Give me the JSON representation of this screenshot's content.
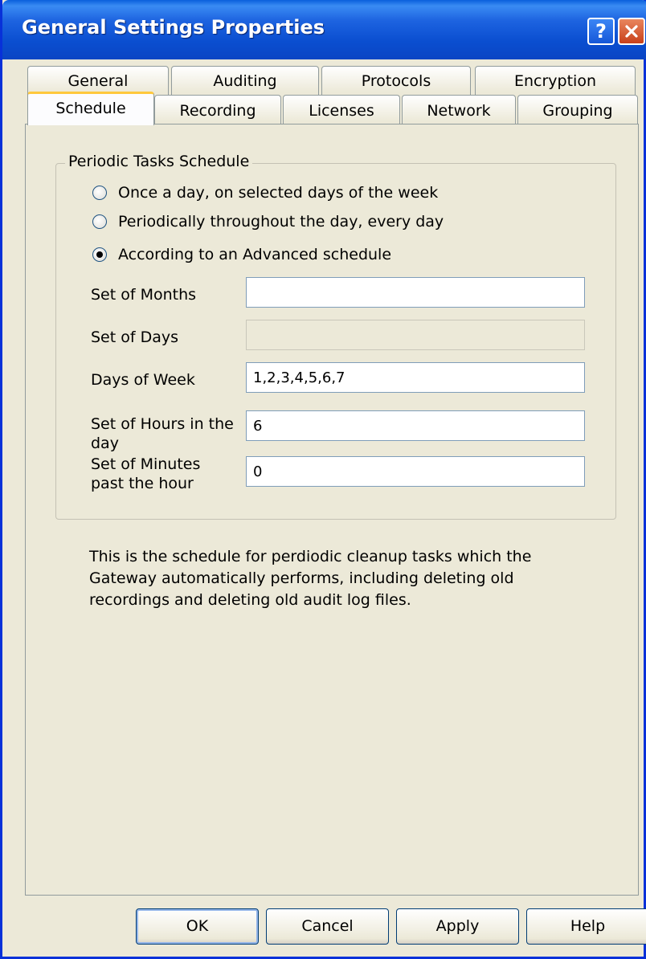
{
  "window": {
    "title": "General Settings Properties",
    "help_glyph": "?",
    "close_glyph": "×"
  },
  "tabs_back": [
    {
      "label": "General"
    },
    {
      "label": "Auditing"
    },
    {
      "label": "Protocols"
    },
    {
      "label": "Encryption"
    }
  ],
  "tabs_front": [
    {
      "label": "Schedule",
      "active": true
    },
    {
      "label": "Recording"
    },
    {
      "label": "Licenses"
    },
    {
      "label": "Network"
    },
    {
      "label": "Grouping"
    }
  ],
  "schedule": {
    "group_title": "Periodic Tasks Schedule",
    "radios": [
      {
        "label": "Once a day, on selected days of the week",
        "checked": false
      },
      {
        "label": "Periodically throughout the day, every day",
        "checked": false
      },
      {
        "label": "According to an Advanced schedule",
        "checked": true
      }
    ],
    "fields": [
      {
        "label": "Set of Months",
        "value": ""
      },
      {
        "label": "Set of Days",
        "value": ""
      },
      {
        "label": "Days of Week",
        "value": "1,2,3,4,5,6,7"
      },
      {
        "label": "Set of Hours in the day",
        "value": "6"
      },
      {
        "label": "Set of Minutes past the hour",
        "value": "0"
      }
    ],
    "description": "This is the schedule for perdiodic cleanup tasks which the Gateway automatically performs, including deleting old recordings and deleting old audit log files."
  },
  "buttons": {
    "ok": "OK",
    "cancel": "Cancel",
    "apply": "Apply",
    "help": "Help"
  },
  "colors": {
    "titlebar": "#0a4ed0",
    "face": "#ece9d8",
    "active_tab_highlight": "#ffc83c"
  }
}
